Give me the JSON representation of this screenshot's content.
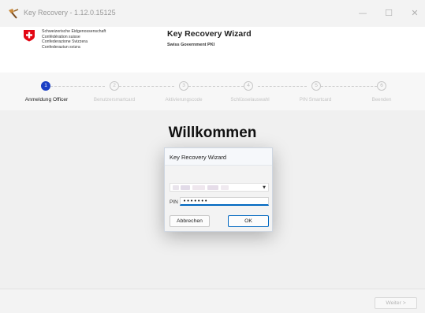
{
  "window": {
    "title": "Key Recovery - 1.12.0.15125",
    "minimize_glyph": "—",
    "maximize_glyph": "☐",
    "close_glyph": "✕"
  },
  "header": {
    "confederation_lines": [
      "Schweizerische Eidgenossenschaft",
      "Confédération suisse",
      "Confederazione Svizzera",
      "Confederaziun svizra"
    ],
    "title": "Key Recovery Wizard",
    "subtitle": "Swiss Government PKI"
  },
  "stepper": {
    "steps": [
      {
        "number": "1",
        "label": "Anmeldung Officer",
        "active": true
      },
      {
        "number": "2",
        "label": "Benutzersmartcard",
        "active": false
      },
      {
        "number": "3",
        "label": "Aktivierungscode",
        "active": false
      },
      {
        "number": "4",
        "label": "Schlüsselauswahl",
        "active": false
      },
      {
        "number": "5",
        "label": "PIN Smartcard",
        "active": false
      },
      {
        "number": "6",
        "label": "Beenden",
        "active": false
      }
    ]
  },
  "content": {
    "heading": "Willkommen"
  },
  "dialog": {
    "title": "Key Recovery Wizard",
    "select_arrow": "▼",
    "pin_label": "PIN",
    "pin_value": "•••••••",
    "cancel_label": "Abbrechen",
    "ok_label": "OK"
  },
  "footer": {
    "next_label": "Weiter >"
  },
  "colors": {
    "accent": "#1a3fc4",
    "focus": "#0067c0",
    "swiss_red": "#e30613"
  },
  "icons": {
    "app": "key-recovery-app-icon",
    "flag": "swiss-cross-icon",
    "dropdown": "chevron-down-icon"
  }
}
